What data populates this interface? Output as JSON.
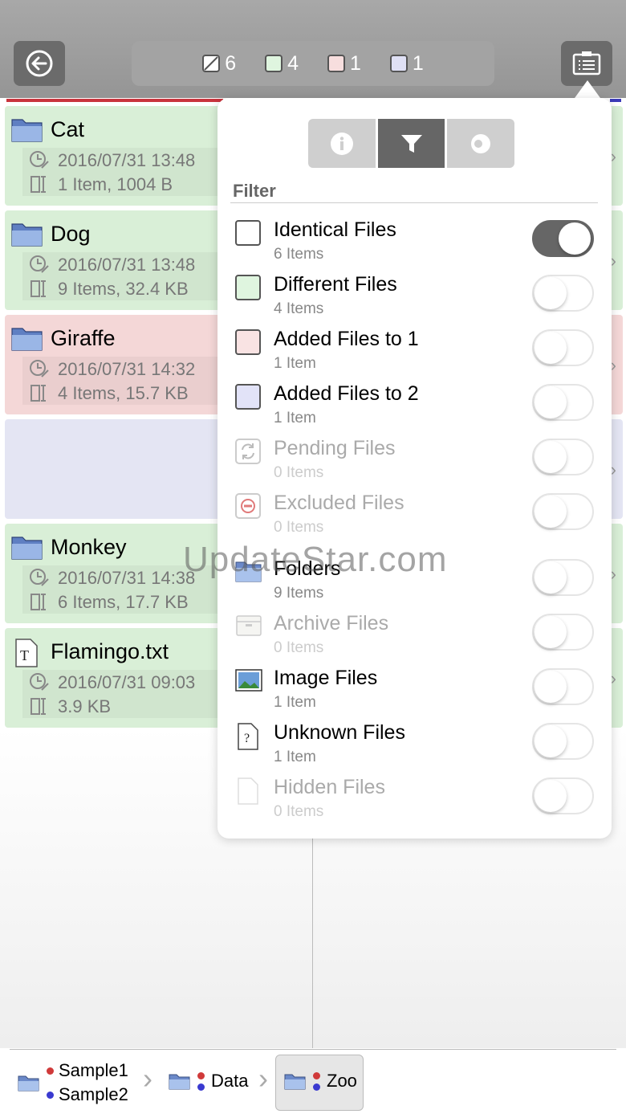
{
  "toolbar": {
    "back_icon": "back-arrow-circle-icon",
    "menu_icon": "list-panel-icon",
    "summary": [
      {
        "icon": "identical-square",
        "color": "#ffffff",
        "count": "6"
      },
      {
        "icon": "different-square",
        "color": "#dff5df",
        "count": "4"
      },
      {
        "icon": "added1-square",
        "color": "#f7dede",
        "count": "1"
      },
      {
        "icon": "added2-square",
        "color": "#dfe0f5",
        "count": "1"
      }
    ]
  },
  "list": {
    "rows": [
      {
        "name": "Cat",
        "date": "2016/07/31 13:48",
        "info": "1 Item, 1004 B",
        "bg": "#d9efd7"
      },
      {
        "name": "Dog",
        "date": "2016/07/31 13:48",
        "info": "9 Items, 32.4 KB",
        "bg": "#d9efd7"
      },
      {
        "name": "Giraffe",
        "date": "2016/07/31 14:32",
        "info": "4 Items, 15.7 KB",
        "bg": "#f4d7d7"
      },
      {
        "name": "",
        "date": "",
        "info": "",
        "bg": "#e4e5f3"
      },
      {
        "name": "Monkey",
        "date": "2016/07/31 14:38",
        "info": "6 Items, 17.7 KB",
        "bg": "#d9efd7"
      },
      {
        "name": "Flamingo.txt",
        "date": "2016/07/31 09:03",
        "info": "3.9 KB",
        "bg": "#d9efd7"
      }
    ]
  },
  "popover": {
    "tabs": [
      {
        "icon": "info-icon"
      },
      {
        "icon": "filter-icon"
      },
      {
        "icon": "eye-icon"
      }
    ],
    "filter_title": "Filter",
    "filters": [
      {
        "label": "Identical Files",
        "count": "6 Items",
        "icon": "identical-square",
        "on": true,
        "dim": false
      },
      {
        "label": "Different Files",
        "count": "4 Items",
        "icon": "different-square",
        "on": false,
        "dim": false
      },
      {
        "label": "Added Files to 1",
        "count": "1 Item",
        "icon": "added1-square",
        "on": false,
        "dim": false
      },
      {
        "label": "Added Files to 2",
        "count": "1 Item",
        "icon": "added2-square",
        "on": false,
        "dim": false
      },
      {
        "label": "Pending Files",
        "count": "0 Items",
        "icon": "pending-icon",
        "on": false,
        "dim": true
      },
      {
        "label": "Excluded Files",
        "count": "0 Items",
        "icon": "excluded-icon",
        "on": false,
        "dim": true
      },
      {
        "label": "Folders",
        "count": "9 Items",
        "icon": "folder-icon",
        "on": false,
        "dim": false
      },
      {
        "label": "Archive Files",
        "count": "0 Items",
        "icon": "archive-icon",
        "on": false,
        "dim": true
      },
      {
        "label": "Image Files",
        "count": "1 Item",
        "icon": "image-icon",
        "on": false,
        "dim": false
      },
      {
        "label": "Unknown Files",
        "count": "1 Item",
        "icon": "unknown-file-icon",
        "on": false,
        "dim": false
      },
      {
        "label": "Hidden Files",
        "count": "0 Items",
        "icon": "hidden-file-icon",
        "on": false,
        "dim": true
      }
    ]
  },
  "breadcrumb": {
    "root_a": "Sample1",
    "root_b": "Sample2",
    "item2": "Data",
    "item3": "Zoo",
    "color_a": "#d03a3a",
    "color_b": "#3a3ad0"
  },
  "watermark": "UpdateStar.com"
}
